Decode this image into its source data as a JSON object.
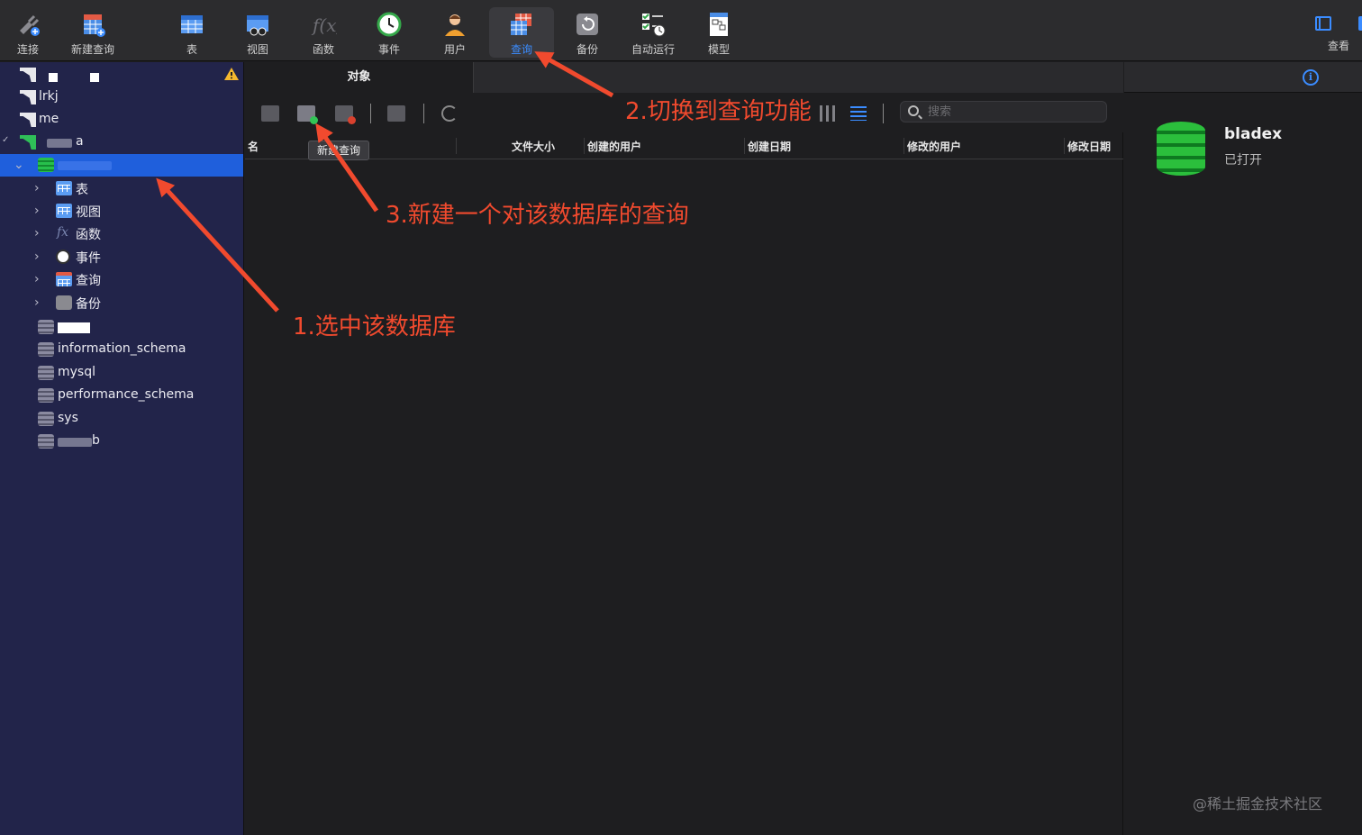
{
  "toolbar": {
    "items": [
      {
        "label": "连接",
        "icon": "connection-plug-icon"
      },
      {
        "label": "新建查询",
        "icon": "new-query-icon"
      },
      {
        "label": "表",
        "icon": "table-icon"
      },
      {
        "label": "视图",
        "icon": "view-icon"
      },
      {
        "label": "函数",
        "icon": "function-icon"
      },
      {
        "label": "事件",
        "icon": "event-clock-icon"
      },
      {
        "label": "用户",
        "icon": "user-icon"
      },
      {
        "label": "查询",
        "icon": "query-icon",
        "active": true
      },
      {
        "label": "备份",
        "icon": "backup-icon"
      },
      {
        "label": "自动运行",
        "icon": "automation-icon"
      },
      {
        "label": "模型",
        "icon": "model-icon"
      }
    ],
    "view_label": "查看"
  },
  "sidebar": {
    "connections": [
      {
        "label": "lrkj"
      },
      {
        "label": "me"
      },
      {
        "label": "a"
      }
    ],
    "nodes": [
      {
        "label": "表"
      },
      {
        "label": "视图"
      },
      {
        "label": "函数"
      },
      {
        "label": "事件"
      },
      {
        "label": "查询"
      },
      {
        "label": "备份"
      }
    ],
    "databases": [
      {
        "label": "information_schema"
      },
      {
        "label": "mysql"
      },
      {
        "label": "performance_schema"
      },
      {
        "label": "sys"
      }
    ],
    "partial_db_suffix": "b"
  },
  "main": {
    "tab_label": "对象",
    "search_placeholder": "搜索",
    "tooltip": "新建查询",
    "columns": [
      "名",
      "文件大小",
      "创建的用户",
      "创建日期",
      "修改的用户",
      "修改日期"
    ]
  },
  "info": {
    "db_name": "bladex",
    "db_status": "已打开"
  },
  "annotations": {
    "step1": "1.选中该数据库",
    "step2": "2.切换到查询功能",
    "step3": "3.新建一个对该数据库的查询",
    "color": "#f14a2e"
  },
  "watermark": "@稀土掘金技术社区",
  "colors": {
    "accent": "#3b8cff",
    "selection": "#1f5fdc",
    "sidebar_bg": "#22244a"
  }
}
